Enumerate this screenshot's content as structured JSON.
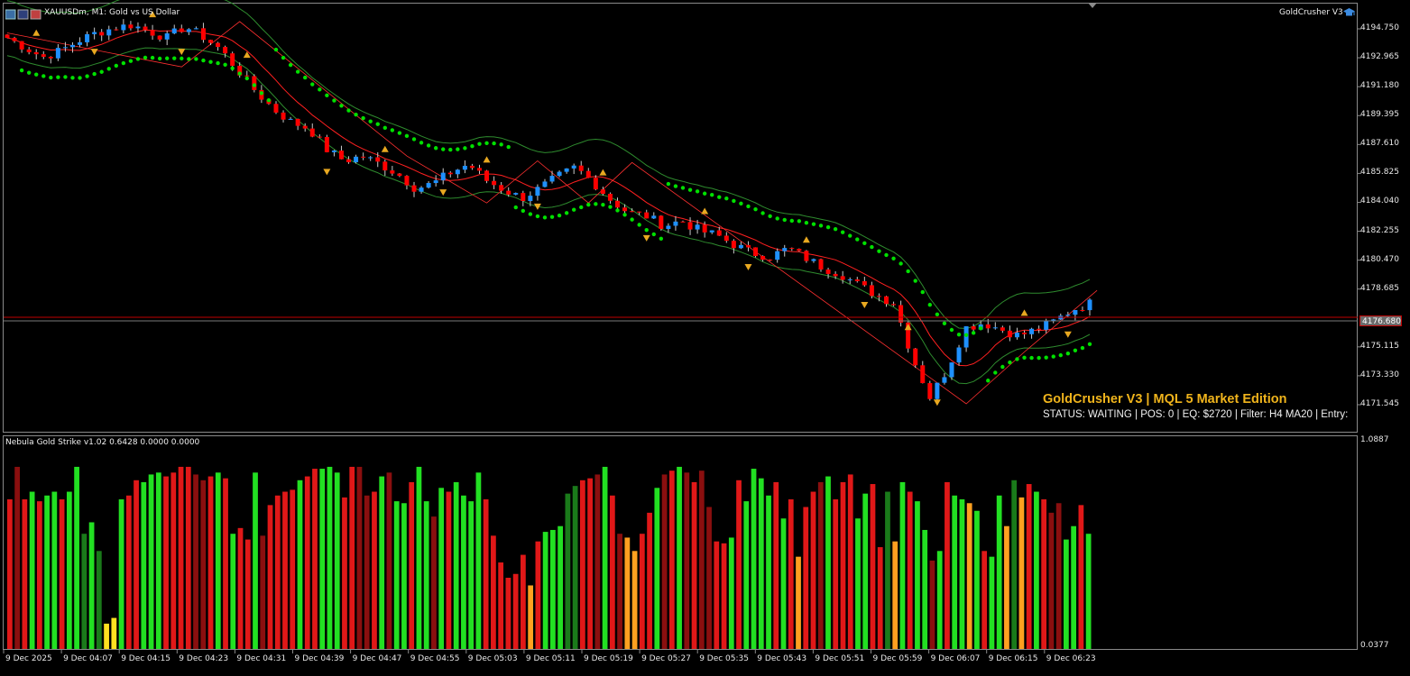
{
  "window": {
    "symbol_title": "XAUUSDm, M1:  Gold vs US Dollar",
    "ea_name": "GoldCrusher V3",
    "ea_icon": "graduation-cap-icon"
  },
  "overlay": {
    "title": "GoldCrusher V3 | MQL 5 Market Edition",
    "status": "STATUS: WAITING | POS: 0 | EQ: $2720 | Filter: H4 MA20 | Entry:"
  },
  "current_price": "4176.680",
  "price_axis": [
    "4194.750",
    "4192.965",
    "4191.180",
    "4189.395",
    "4187.610",
    "4185.825",
    "4184.040",
    "4182.255",
    "4180.470",
    "4178.685",
    "4175.115",
    "4173.330",
    "4171.545"
  ],
  "time_axis": [
    "9 Dec 2025",
    "9 Dec 04:07",
    "9 Dec 04:15",
    "9 Dec 04:23",
    "9 Dec 04:31",
    "9 Dec 04:39",
    "9 Dec 04:47",
    "9 Dec 04:55",
    "9 Dec 05:03",
    "9 Dec 05:11",
    "9 Dec 05:19",
    "9 Dec 05:27",
    "9 Dec 05:35",
    "9 Dec 05:43",
    "9 Dec 05:51",
    "9 Dec 05:59",
    "9 Dec 06:07",
    "9 Dec 06:15",
    "9 Dec 06:23"
  ],
  "indicator": {
    "title": "Nebula Gold Strike v1.02 0.6428 0.0000 0.0000",
    "axis_max": "1.0887",
    "axis_min": "0.0377"
  },
  "colors": {
    "bull_candle": "#1e90ff",
    "bear_candle": "#ff0000",
    "dots": "#00e000",
    "envelope": "#2e8b2e",
    "ma_line": "#ff2020",
    "arrow": "#e8a820",
    "hist_green": "#22e022",
    "hist_darkgreen": "#1a7a1a",
    "hist_red": "#e01818",
    "hist_darkred": "#8a0f0f",
    "hist_orange": "#ffa020",
    "hist_yellow": "#ffe020"
  },
  "chart_data": {
    "type": "candlestick",
    "symbol": "XAUUSDm",
    "timeframe": "M1",
    "approx_close_path": [
      4194.2,
      4193.6,
      4193.0,
      4193.4,
      4194.0,
      4194.5,
      4194.8,
      4195.0,
      4194.6,
      4194.2,
      4194.9,
      4194.3,
      4193.5,
      4192.2,
      4190.9,
      4189.8,
      4189.0,
      4188.6,
      4187.3,
      4186.6,
      4186.9,
      4186.4,
      4185.8,
      4184.9,
      4185.2,
      4185.9,
      4186.4,
      4185.4,
      4184.8,
      4184.3,
      4184.9,
      4185.6,
      4186.2,
      4185.3,
      4184.2,
      4183.4,
      4183.2,
      4182.6,
      4182.9,
      4182.3,
      4182.0,
      4181.4,
      4180.9,
      4180.7,
      4181.2,
      4180.6,
      4180.0,
      4179.6,
      4178.9,
      4178.3,
      4177.8,
      4174.5,
      4172.0,
      4173.8,
      4176.3,
      4176.6,
      4176.2,
      4175.8,
      4176.2,
      4176.7,
      4177.4,
      4177.8
    ],
    "current_price": 4176.68,
    "histogram": {
      "name": "Nebula Gold Strike v1.02",
      "colors": [
        "red",
        "darkred",
        "red",
        "green",
        "red",
        "green",
        "green",
        "red",
        "green",
        "green",
        "darkgreen",
        "green",
        "darkgreen",
        "yellow",
        "yellow",
        "green",
        "red",
        "red",
        "green",
        "green",
        "green",
        "red",
        "red",
        "red",
        "red",
        "darkred",
        "darkred",
        "red",
        "green",
        "red",
        "green",
        "red",
        "red",
        "green",
        "darkred",
        "red",
        "red",
        "red",
        "red",
        "green",
        "red",
        "red",
        "green",
        "green",
        "green",
        "red",
        "red",
        "darkred",
        "darkred",
        "red",
        "green",
        "darkred",
        "green",
        "green",
        "red",
        "green",
        "green",
        "darkred",
        "green",
        "red",
        "green",
        "green",
        "green",
        "green",
        "red",
        "red",
        "red",
        "red",
        "red",
        "red",
        "orange",
        "red",
        "green",
        "green",
        "green",
        "darkgreen",
        "darkgreen",
        "red",
        "red",
        "darkred",
        "green",
        "red",
        "darkred",
        "orange",
        "orange",
        "red",
        "red",
        "green",
        "darkred",
        "red",
        "green",
        "darkred",
        "red",
        "darkred",
        "darkred",
        "red",
        "red",
        "green",
        "red",
        "green",
        "green",
        "green",
        "green",
        "red",
        "green",
        "red",
        "orange",
        "red",
        "red",
        "darkred",
        "green",
        "red",
        "red",
        "red",
        "green",
        "green",
        "red",
        "red",
        "darkgreen",
        "orange",
        "green",
        "red",
        "green",
        "green",
        "darkred",
        "green",
        "red",
        "green",
        "green",
        "orange",
        "green",
        "red",
        "green",
        "green",
        "orange",
        "darkgreen",
        "orange",
        "red",
        "green",
        "red",
        "darkred",
        "darkred",
        "green",
        "green",
        "red",
        "green",
        "green",
        "green",
        "red"
      ],
      "values": [
        0.82,
        0.99,
        0.82,
        0.86,
        0.81,
        0.84,
        0.86,
        0.82,
        0.86,
        0.99,
        0.64,
        0.7,
        0.55,
        0.17,
        0.2,
        0.82,
        0.84,
        0.92,
        0.91,
        0.95,
        0.96,
        0.94,
        0.96,
        0.99,
        0.99,
        0.95,
        0.92,
        0.94,
        0.96,
        0.93,
        0.64,
        0.67,
        0.61,
        0.96,
        0.63,
        0.79,
        0.84,
        0.86,
        0.87,
        0.92,
        0.94,
        0.98,
        0.98,
        0.99,
        0.96,
        0.83,
        0.99,
        0.99,
        0.84,
        0.86,
        0.94,
        0.96,
        0.81,
        0.8,
        0.91,
        0.99,
        0.81,
        0.73,
        0.88,
        0.86,
        0.91,
        0.84,
        0.81,
        0.96,
        0.82,
        0.63,
        0.49,
        0.41,
        0.43,
        0.53,
        0.37,
        0.6,
        0.65,
        0.66,
        0.68,
        0.85,
        0.89,
        0.92,
        0.93,
        0.95,
        0.99,
        0.84,
        0.64,
        0.62,
        0.55,
        0.64,
        0.75,
        0.88,
        0.95,
        0.97,
        0.99,
        0.96,
        0.91,
        0.97,
        0.78,
        0.6,
        0.59,
        0.62,
        0.92,
        0.81,
        0.98,
        0.93,
        0.84,
        0.91,
        0.72,
        0.82,
        0.52,
        0.78,
        0.86,
        0.91,
        0.94,
        0.82,
        0.91,
        0.95,
        0.72,
        0.85,
        0.9,
        0.57,
        0.86,
        0.6,
        0.91,
        0.86,
        0.81,
        0.66,
        0.5,
        0.55,
        0.91,
        0.84,
        0.82,
        0.8,
        0.76,
        0.55,
        0.52,
        0.84,
        0.68,
        0.92,
        0.83,
        0.9,
        0.86,
        0.82,
        0.75,
        0.8,
        0.61,
        0.68,
        0.79,
        0.64
      ]
    }
  }
}
